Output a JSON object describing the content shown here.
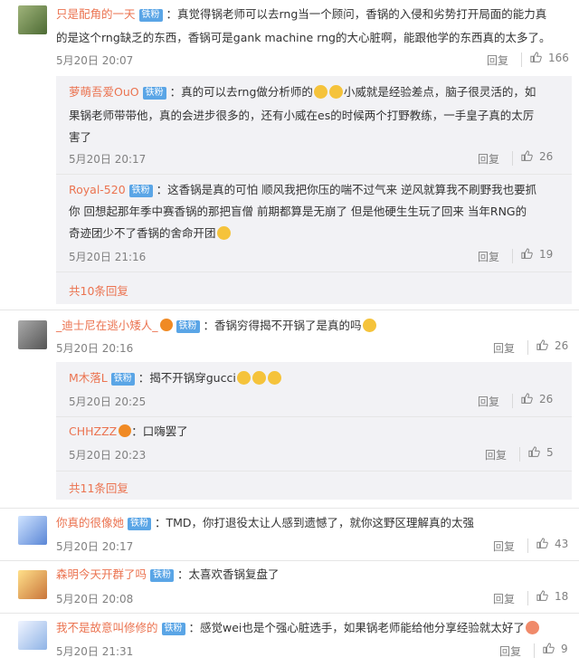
{
  "comments": [
    {
      "username": "只是配角的一天",
      "badge": "铁粉",
      "text1": "：真觉得锅老师可以去rng当一个顾问，香锅的入侵和劣势打开局面的能力真",
      "text2": "的是这个rng缺乏的东西，香锅可是gank machine rng的大心脏啊，能跟他学的东西真的太多了。",
      "date": "5月20日 20:07",
      "reply": "回复",
      "likes": "166",
      "replies": [
        {
          "username": "萝萌吾爱OuO",
          "badge": "铁粉",
          "text1a": "：真的可以去rng做分析师的",
          "text1b": "小威就是经验差点，脑子很灵活的，如",
          "text2": "果锅老师带带他，真的会进步很多的，还有小威在es的时候两个打野教练，一手皇子真的太厉",
          "text3": "害了",
          "date": "5月20日 20:17",
          "reply": "回复",
          "likes": "26"
        },
        {
          "username": "Royal-520",
          "badge": "铁粉",
          "text1": "：这香锅是真的可怕  顺风我把你压的喘不过气来  逆风就算我不刷野我也要抓",
          "text2": "你  回想起那年季中赛香锅的那把盲僧  前期都算是无崩了  但是他硬生生玩了回来  当年RNG的",
          "text3": "奇迹团少不了香锅的舍命开团",
          "date": "5月20日 21:16",
          "reply": "回复",
          "likes": "19"
        }
      ],
      "more": "共10条回复"
    },
    {
      "username": "_迪士尼在逃小矮人_",
      "badge": "铁粉",
      "text1": "：香锅穷得揭不开锅了是真的吗",
      "date": "5月20日 20:16",
      "reply": "回复",
      "likes": "26",
      "replies": [
        {
          "username": "M木落L",
          "badge": "铁粉",
          "text1": "：揭不开锅穿gucci",
          "date": "5月20日 20:25",
          "reply": "回复",
          "likes": "26"
        },
        {
          "username": "CHHZZZ",
          "text1": "：口嗨罢了",
          "date": "5月20日 20:23",
          "reply": "回复",
          "likes": "5"
        }
      ],
      "more": "共11条回复"
    },
    {
      "username": "你真的很像她",
      "badge": "铁粉",
      "text1": "：TMD，你打退役太让人感到遗憾了，就你这野区理解真的太强",
      "date": "5月20日 20:17",
      "reply": "回复",
      "likes": "43"
    },
    {
      "username": "森明今天开群了吗",
      "badge": "铁粉",
      "text1": "：太喜欢香锅复盘了",
      "date": "5月20日 20:08",
      "reply": "回复",
      "likes": "18"
    },
    {
      "username": "我不是故意叫修修的",
      "badge": "铁粉",
      "text1": "：感觉wei也是个强心脏选手，如果锅老师能给他分享经验就太好了",
      "date": "5月20日 21:31",
      "reply": "回复",
      "likes": "9"
    }
  ]
}
